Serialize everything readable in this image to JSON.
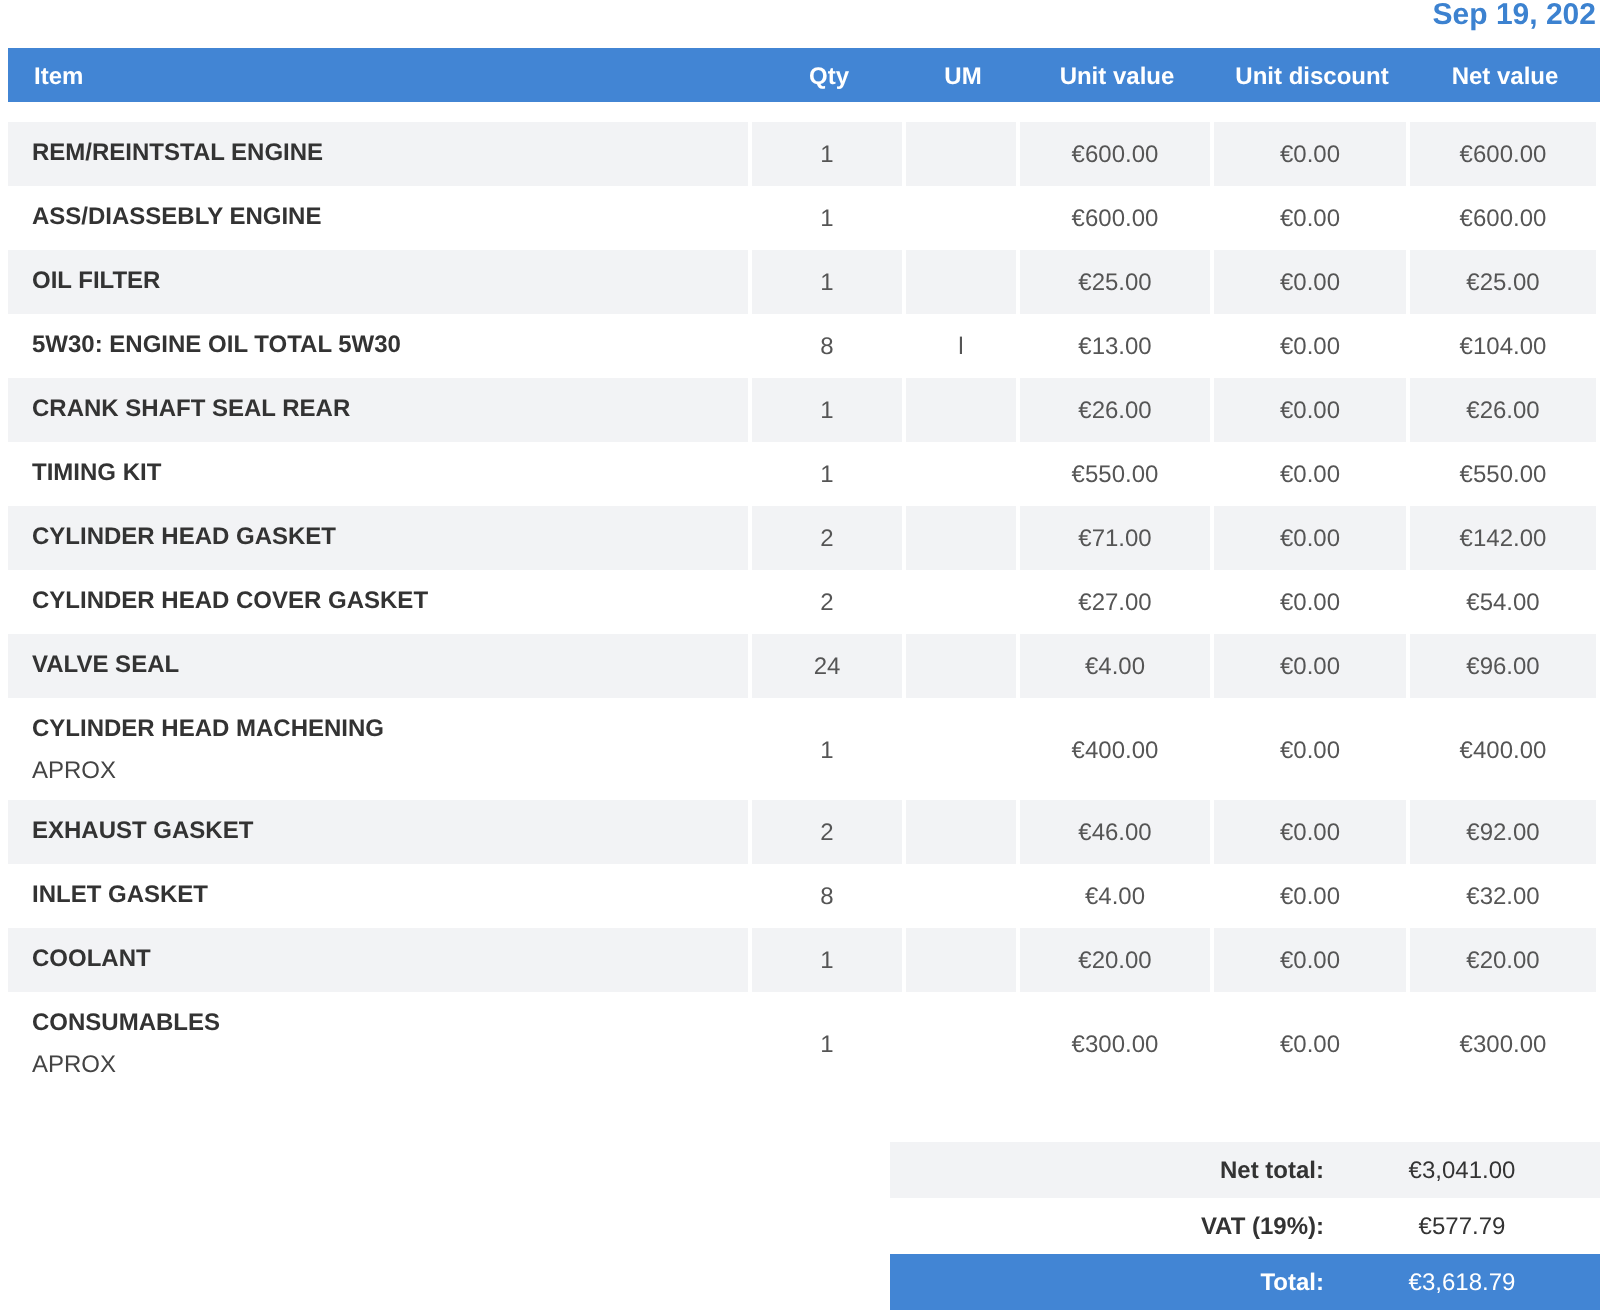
{
  "date": "Sep 19, 202",
  "table": {
    "columns": [
      "Item",
      "Qty",
      "UM",
      "Unit value",
      "Unit discount",
      "Net value"
    ],
    "rows": [
      {
        "item": "REM/REINTSTAL ENGINE",
        "qty": "1",
        "um": "",
        "unit_value": "€600.00",
        "unit_discount": "€0.00",
        "net_value": "€600.00"
      },
      {
        "item": "ASS/DIASSEBLY ENGINE",
        "qty": "1",
        "um": "",
        "unit_value": "€600.00",
        "unit_discount": "€0.00",
        "net_value": "€600.00"
      },
      {
        "item": "OIL FILTER",
        "qty": "1",
        "um": "",
        "unit_value": "€25.00",
        "unit_discount": "€0.00",
        "net_value": "€25.00"
      },
      {
        "item": "5W30: ENGINE OIL TOTAL 5W30",
        "qty": "8",
        "um": "l",
        "unit_value": "€13.00",
        "unit_discount": "€0.00",
        "net_value": "€104.00"
      },
      {
        "item": "CRANK SHAFT SEAL REAR",
        "qty": "1",
        "um": "",
        "unit_value": "€26.00",
        "unit_discount": "€0.00",
        "net_value": "€26.00"
      },
      {
        "item": "TIMING KIT",
        "qty": "1",
        "um": "",
        "unit_value": "€550.00",
        "unit_discount": "€0.00",
        "net_value": "€550.00"
      },
      {
        "item": "CYLINDER HEAD GASKET",
        "qty": "2",
        "um": "",
        "unit_value": "€71.00",
        "unit_discount": "€0.00",
        "net_value": "€142.00"
      },
      {
        "item": "CYLINDER HEAD COVER GASKET",
        "qty": "2",
        "um": "",
        "unit_value": "€27.00",
        "unit_discount": "€0.00",
        "net_value": "€54.00"
      },
      {
        "item": "VALVE SEAL",
        "qty": "24",
        "um": "",
        "unit_value": "€4.00",
        "unit_discount": "€0.00",
        "net_value": "€96.00"
      },
      {
        "item": "CYLINDER HEAD MACHENING",
        "note": "APROX",
        "qty": "1",
        "um": "",
        "unit_value": "€400.00",
        "unit_discount": "€0.00",
        "net_value": "€400.00"
      },
      {
        "item": "EXHAUST GASKET",
        "qty": "2",
        "um": "",
        "unit_value": "€46.00",
        "unit_discount": "€0.00",
        "net_value": "€92.00"
      },
      {
        "item": "INLET GASKET",
        "qty": "8",
        "um": "",
        "unit_value": "€4.00",
        "unit_discount": "€0.00",
        "net_value": "€32.00"
      },
      {
        "item": "COOLANT",
        "qty": "1",
        "um": "",
        "unit_value": "€20.00",
        "unit_discount": "€0.00",
        "net_value": "€20.00"
      },
      {
        "item": "CONSUMABLES",
        "note": "APROX",
        "qty": "1",
        "um": "",
        "unit_value": "€300.00",
        "unit_discount": "€0.00",
        "net_value": "€300.00"
      }
    ]
  },
  "totals": [
    {
      "kind": "net",
      "label": "Net total:",
      "value": "€3,041.00"
    },
    {
      "kind": "vat",
      "label": "VAT (19%):",
      "value": "€577.79"
    },
    {
      "kind": "total",
      "label": "Total:",
      "value": "€3,618.79"
    }
  ]
}
